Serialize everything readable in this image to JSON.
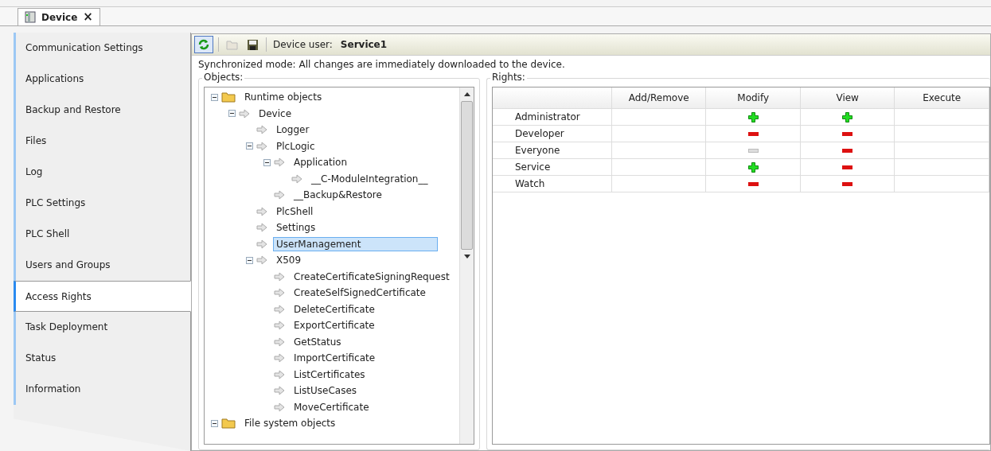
{
  "editor_tab": {
    "title": "Device",
    "close": "×",
    "selected": true
  },
  "sidebar": {
    "items": [
      {
        "label": "Communication Settings",
        "selected": false
      },
      {
        "label": "Applications",
        "selected": false
      },
      {
        "label": "Backup and Restore",
        "selected": false
      },
      {
        "label": "Files",
        "selected": false
      },
      {
        "label": "Log",
        "selected": false
      },
      {
        "label": "PLC Settings",
        "selected": false
      },
      {
        "label": "PLC Shell",
        "selected": false
      },
      {
        "label": "Users and Groups",
        "selected": false
      },
      {
        "label": "Access Rights",
        "selected": true
      },
      {
        "label": "Task Deployment",
        "selected": false
      },
      {
        "label": "Status",
        "selected": false
      },
      {
        "label": "Information",
        "selected": false
      }
    ]
  },
  "toolbar": {
    "device_user_label": "Device user:",
    "device_user": "Service1",
    "sync_on": true
  },
  "info": "Synchronized mode: All changes are immediately downloaded to the device.",
  "objects": {
    "title": "Objects:",
    "tree": [
      {
        "label": "Runtime objects",
        "kind": "folder",
        "expanded": true,
        "selected": false,
        "children": [
          {
            "label": "Device",
            "kind": "object",
            "expanded": true,
            "selected": false,
            "children": [
              {
                "label": "Logger",
                "kind": "object",
                "selected": false
              },
              {
                "label": "PlcLogic",
                "kind": "object",
                "expanded": true,
                "selected": false,
                "children": [
                  {
                    "label": "Application",
                    "kind": "object",
                    "expanded": true,
                    "selected": false,
                    "children": [
                      {
                        "label": "__C-ModuleIntegration__",
                        "kind": "object",
                        "selected": false
                      }
                    ]
                  },
                  {
                    "label": "__Backup&Restore",
                    "kind": "object",
                    "selected": false
                  }
                ]
              },
              {
                "label": "PlcShell",
                "kind": "object",
                "selected": false
              },
              {
                "label": "Settings",
                "kind": "object",
                "selected": false
              },
              {
                "label": "UserManagement",
                "kind": "object",
                "selected": true
              },
              {
                "label": "X509",
                "kind": "object",
                "expanded": true,
                "selected": false,
                "children": [
                  {
                    "label": "CreateCertificateSigningRequest",
                    "kind": "object",
                    "selected": false
                  },
                  {
                    "label": "CreateSelfSignedCertificate",
                    "kind": "object",
                    "selected": false
                  },
                  {
                    "label": "DeleteCertificate",
                    "kind": "object",
                    "selected": false
                  },
                  {
                    "label": "ExportCertificate",
                    "kind": "object",
                    "selected": false
                  },
                  {
                    "label": "GetStatus",
                    "kind": "object",
                    "selected": false
                  },
                  {
                    "label": "ImportCertificate",
                    "kind": "object",
                    "selected": false
                  },
                  {
                    "label": "ListCertificates",
                    "kind": "object",
                    "selected": false
                  },
                  {
                    "label": "ListUseCases",
                    "kind": "object",
                    "selected": false
                  },
                  {
                    "label": "MoveCertificate",
                    "kind": "object",
                    "selected": false
                  }
                ]
              }
            ]
          }
        ]
      },
      {
        "label": "File system objects",
        "kind": "folder",
        "expanded": true,
        "selected": false
      }
    ]
  },
  "rights": {
    "title": "Rights:",
    "columns": [
      "Add/Remove",
      "Modify",
      "View",
      "Execute"
    ],
    "rows": [
      {
        "group": "Administrator",
        "cells": [
          {
            "kind": "empty"
          },
          {
            "kind": "plus"
          },
          {
            "kind": "plus"
          },
          {
            "kind": "empty"
          }
        ]
      },
      {
        "group": "Developer",
        "cells": [
          {
            "kind": "empty"
          },
          {
            "kind": "minus"
          },
          {
            "kind": "minus"
          },
          {
            "kind": "empty"
          }
        ]
      },
      {
        "group": "Everyone",
        "cells": [
          {
            "kind": "empty"
          },
          {
            "kind": "grey-minus"
          },
          {
            "kind": "minus"
          },
          {
            "kind": "empty"
          }
        ]
      },
      {
        "group": "Service",
        "cells": [
          {
            "kind": "empty"
          },
          {
            "kind": "plus"
          },
          {
            "kind": "minus"
          },
          {
            "kind": "empty"
          }
        ]
      },
      {
        "group": "Watch",
        "cells": [
          {
            "kind": "empty"
          },
          {
            "kind": "minus"
          },
          {
            "kind": "minus"
          },
          {
            "kind": "empty"
          }
        ]
      }
    ]
  }
}
